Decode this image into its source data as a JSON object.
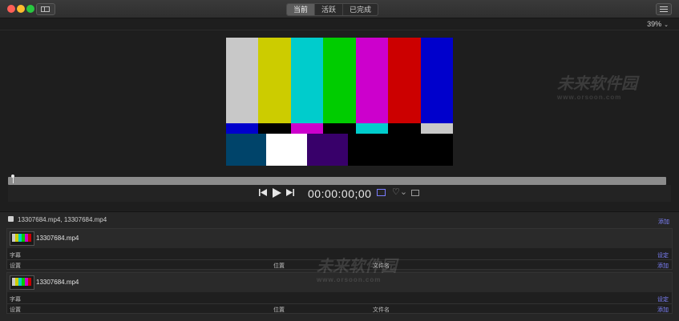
{
  "titlebar": {
    "tabs": [
      {
        "label": "当前",
        "active": true
      },
      {
        "label": "活跃",
        "active": false
      },
      {
        "label": "已完成",
        "active": false
      }
    ]
  },
  "viewer": {
    "zoom": "39%",
    "timecode": "00:00:00;00"
  },
  "colors": {
    "accent": "#7f83ff",
    "bars_top": [
      "#c8c8c8",
      "#cccc00",
      "#00cccc",
      "#00cc00",
      "#cc00cc",
      "#cc0000",
      "#0000cc"
    ],
    "bars_mid": [
      "#0000cc",
      "#000000",
      "#cc00cc",
      "#000000",
      "#00cccc",
      "#000000",
      "#c8c8c8"
    ],
    "bars_bottom": [
      "#00446a",
      "#ffffff",
      "#38006a",
      "#000000",
      "#000000",
      "#000000"
    ]
  },
  "batch": {
    "label": "13307684.mp4, 13307684.mp4",
    "link": "添加"
  },
  "jobs": [
    {
      "title": "13307684.mp4",
      "rows": [
        {
          "label": "字幕",
          "action": "设定"
        },
        {
          "label": "设置",
          "mid1": "位置",
          "mid2": "文件名",
          "action": "添加"
        }
      ]
    },
    {
      "title": "13307684.mp4",
      "rows": [
        {
          "label": "字幕",
          "action": "设定"
        },
        {
          "label": "设置",
          "mid1": "位置",
          "mid2": "文件名",
          "action": "添加"
        }
      ]
    }
  ],
  "watermark": {
    "brand": "未来软件园",
    "url": "www.orsoon.com"
  }
}
